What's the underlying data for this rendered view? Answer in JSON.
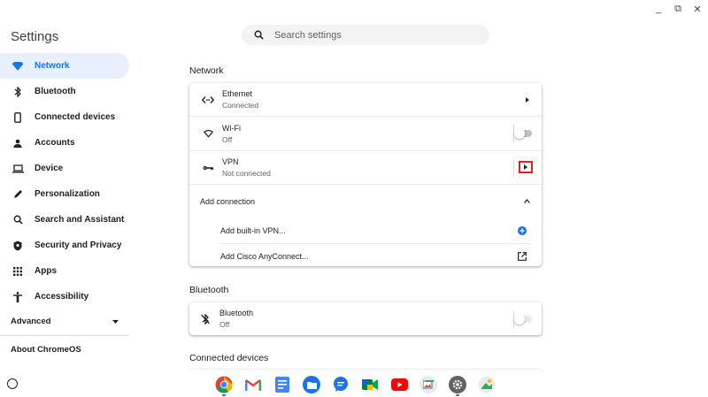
{
  "window_controls": [
    "_",
    "⧉",
    "✕"
  ],
  "app_title": "Settings",
  "search": {
    "placeholder": "Search settings",
    "value": ""
  },
  "sidebar": {
    "items": [
      {
        "label": "Network",
        "icon": "wifi-icon",
        "active": true
      },
      {
        "label": "Bluetooth",
        "icon": "bluetooth-icon"
      },
      {
        "label": "Connected devices",
        "icon": "phone-icon"
      },
      {
        "label": "Accounts",
        "icon": "person-icon"
      },
      {
        "label": "Device",
        "icon": "laptop-icon"
      },
      {
        "label": "Personalization",
        "icon": "pen-icon"
      },
      {
        "label": "Search and Assistant",
        "icon": "search-icon"
      },
      {
        "label": "Security and Privacy",
        "icon": "shield-icon"
      },
      {
        "label": "Apps",
        "icon": "apps-grid-icon"
      },
      {
        "label": "Accessibility",
        "icon": "accessibility-icon"
      }
    ],
    "advanced": "Advanced",
    "about": "About ChromeOS"
  },
  "network": {
    "title": "Network",
    "ethernet": {
      "name": "Ethernet",
      "status": "Connected"
    },
    "wifi": {
      "name": "Wi-Fi",
      "status": "Off",
      "enabled": false
    },
    "vpn": {
      "name": "VPN",
      "status": "Not connected"
    },
    "add_connection": "Add connection",
    "add_vpn": "Add built-in VPN...",
    "add_cisco": "Add Cisco AnyConnect..."
  },
  "bluetooth": {
    "title": "Bluetooth",
    "name": "Bluetooth",
    "status": "Off",
    "enabled": false
  },
  "connected_devices": {
    "title": "Connected devices"
  },
  "shelf_apps": [
    "chrome-icon",
    "gmail-icon",
    "docs-icon",
    "files-icon",
    "messages-icon",
    "meet-icon",
    "youtube-icon",
    "gallery-icon",
    "settings-icon",
    "photos-icon"
  ],
  "colors": {
    "accent": "#1a73e8",
    "active_bg": "#e8f0fe",
    "highlight": "#e8201b"
  }
}
